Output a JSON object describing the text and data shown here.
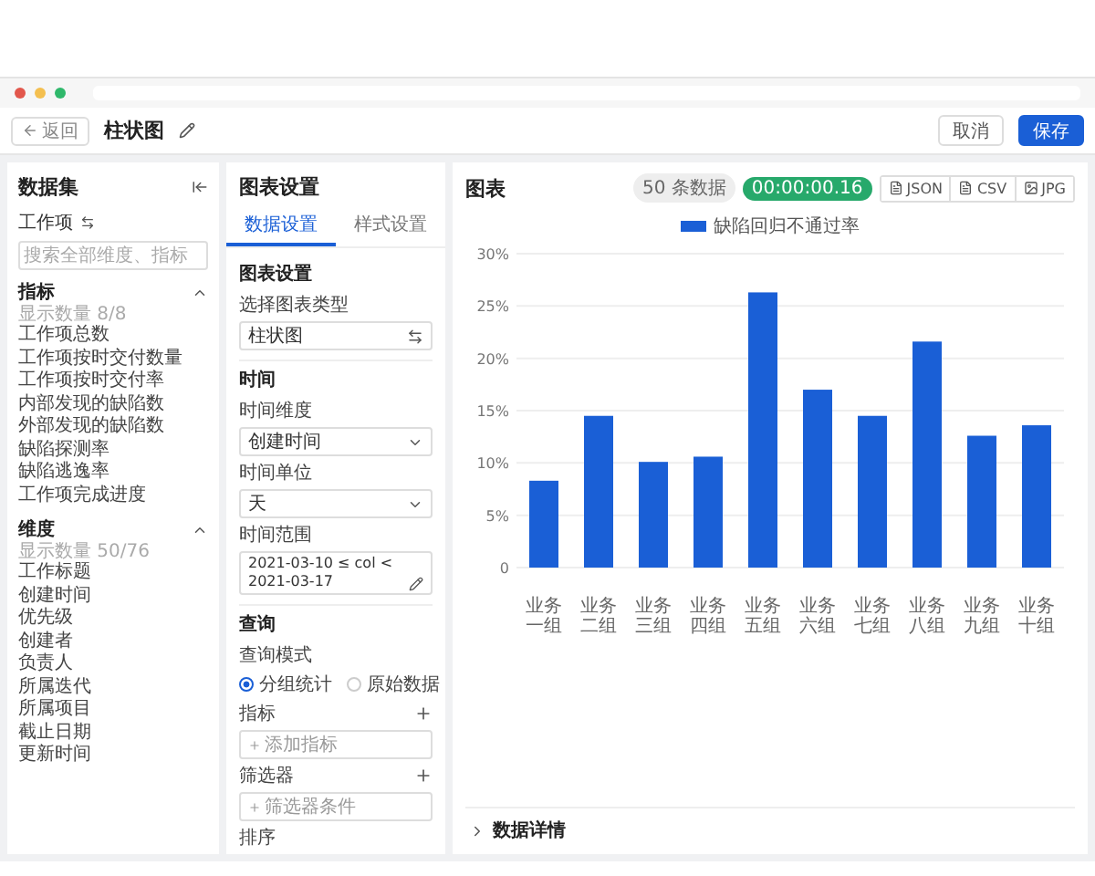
{
  "header": {
    "back_label": "返回",
    "title": "柱状图",
    "buttons": [
      {
        "label": "取消",
        "primary": false
      },
      {
        "label": "保存",
        "primary": true
      }
    ]
  },
  "dataset": {
    "title": "数据集",
    "source": "工作项",
    "search": {
      "placeholder": "搜索全部维度、指标"
    },
    "groups": [
      {
        "title": "指标",
        "subtitle": "显示数量 8/8",
        "expanded": true,
        "items": [
          "工作项总数",
          "工作项按时交付数量",
          "工作项按时交付率",
          "内部发现的缺陷数",
          "外部发现的缺陷数",
          "缺陷探测率",
          "缺陷逃逸率",
          "工作项完成进度"
        ]
      },
      {
        "title": "维度",
        "subtitle": "显示数量 50/76",
        "expanded": true,
        "items": [
          "工作标题",
          "创建时间",
          "优先级",
          "创建者",
          "负责人",
          "所属迭代",
          "所属项目",
          "截止日期",
          "更新时间"
        ]
      }
    ]
  },
  "settings": {
    "title": "图表设置",
    "tabs": [
      {
        "label": "数据设置",
        "selected": true
      },
      {
        "label": "样式设置",
        "selected": false
      }
    ],
    "sections": [
      {
        "title": "图表设置",
        "fields": [
          {
            "kind": "swap",
            "label": "选择图表类型",
            "value": "柱状图"
          }
        ]
      },
      {
        "title": "时间",
        "fields": [
          {
            "kind": "dropdown",
            "label": "时间维度",
            "value": "创建时间"
          },
          {
            "kind": "dropdown",
            "label": "时间单位",
            "value": "天"
          },
          {
            "kind": "edit",
            "label": "时间范围",
            "value": "2021-03-10 ≤ col < 2021-03-17"
          }
        ]
      },
      {
        "title": "查询",
        "fields": [
          {
            "kind": "radio",
            "label": "查询模式",
            "options": [
              {
                "label": "分组统计",
                "selected": true
              },
              {
                "label": "原始数据",
                "selected": false
              }
            ]
          },
          {
            "kind": "add",
            "label": "指标",
            "action": "添加指标"
          },
          {
            "kind": "add",
            "label": "筛选器",
            "action": "筛选器条件"
          },
          {
            "kind": "label",
            "label": "排序"
          }
        ]
      }
    ]
  },
  "chart": {
    "title": "图表",
    "count": "50 条数据",
    "duration": "00:00:00.16",
    "exports": [
      "JSON",
      "CSV",
      "JPG"
    ],
    "chart_data": {
      "type": "bar",
      "categories": [
        "业务一组",
        "业务二组",
        "业务三组",
        "业务四组",
        "业务五组",
        "业务六组",
        "业务七组",
        "业务八组",
        "业务九组",
        "业务十组"
      ],
      "series": [
        {
          "name": "缺陷回归不通过率",
          "color": "#1a5fd6",
          "values": [
            8.3,
            14.5,
            10.1,
            10.6,
            26.3,
            17.0,
            14.5,
            21.6,
            12.6,
            13.6
          ]
        }
      ],
      "ylim": [
        0,
        30
      ],
      "grid": true,
      "yticks": [
        {
          "value": 0,
          "label": "0"
        },
        {
          "value": 5,
          "label": "5%"
        },
        {
          "value": 10,
          "label": "10%"
        },
        {
          "value": 15,
          "label": "15%"
        },
        {
          "value": 20,
          "label": "20%"
        },
        {
          "value": 25,
          "label": "25%"
        },
        {
          "value": 30,
          "label": "30%"
        }
      ]
    },
    "details": {
      "label": "数据详情",
      "expanded": false
    }
  }
}
